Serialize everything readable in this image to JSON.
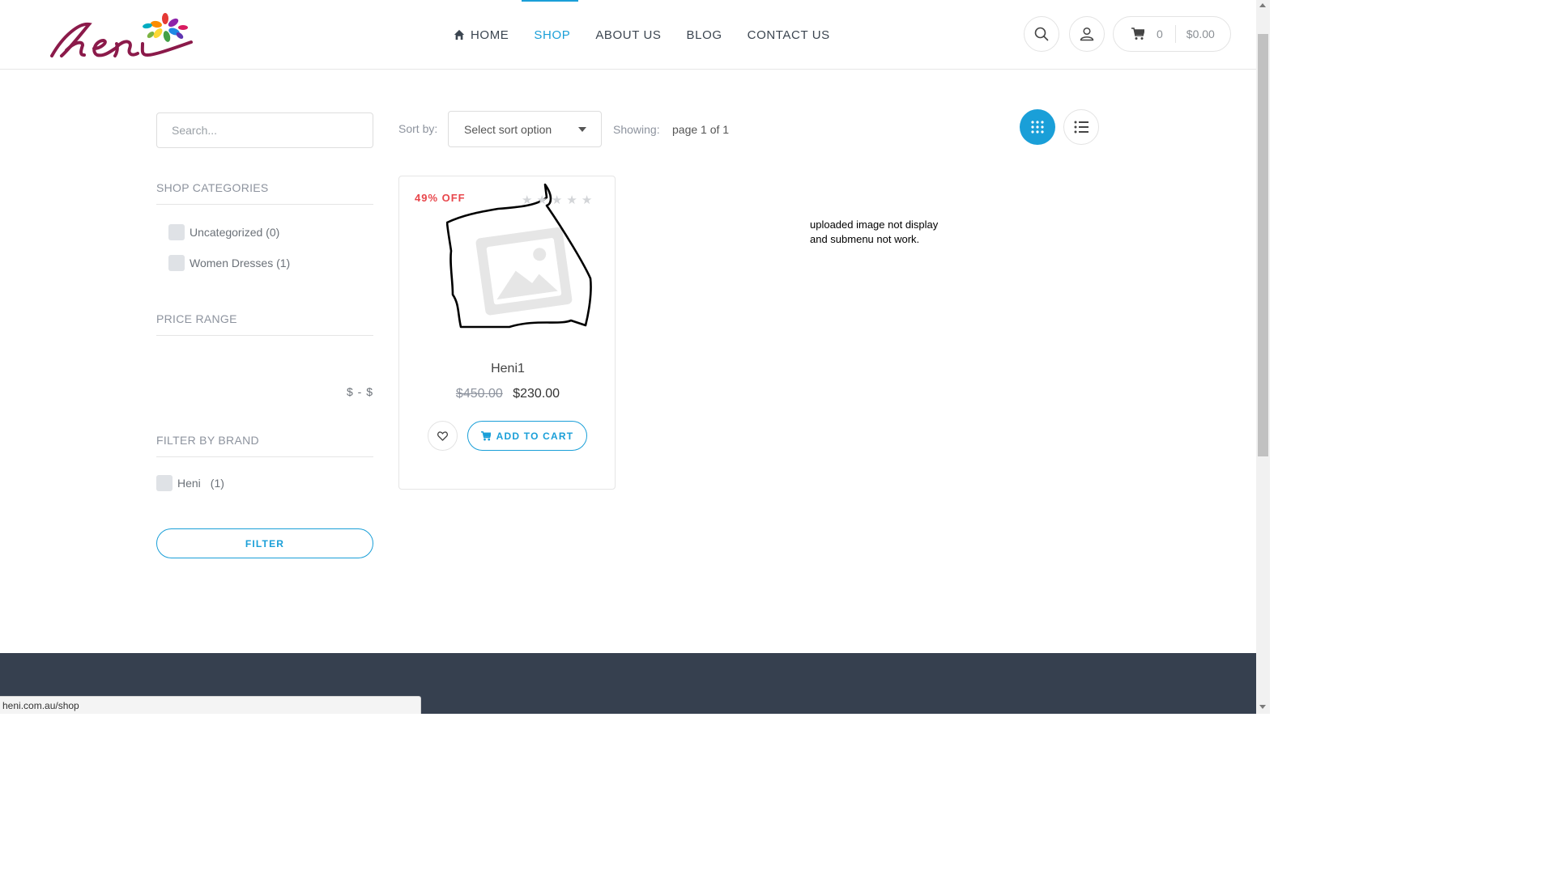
{
  "header": {
    "nav": [
      {
        "label": "HOME",
        "icon": "home-icon",
        "active": false
      },
      {
        "label": "SHOP",
        "active": true
      },
      {
        "label": "ABOUT US",
        "active": false
      },
      {
        "label": "BLOG",
        "active": false
      },
      {
        "label": "CONTACT US",
        "active": false
      }
    ],
    "cart_count": "0",
    "cart_total": "$0.00",
    "accent_color": "#1a9fd8"
  },
  "sidebar": {
    "search_placeholder": "Search...",
    "categories_title": "SHOP CATEGORIES",
    "categories": [
      {
        "label": "Uncategorized (0)"
      },
      {
        "label": "Women Dresses (1)"
      }
    ],
    "price_title": "PRICE RANGE",
    "price_range": "$ -  $",
    "brand_title": "FILTER BY BRAND",
    "brands": [
      {
        "name": "Heni",
        "count": "(1)"
      }
    ],
    "filter_label": "FILTER"
  },
  "toolbar": {
    "sort_label": "Sort by:",
    "sort_value": "Select sort option",
    "showing_label": "Showing:",
    "showing_value": "page 1 of 1"
  },
  "product": {
    "badge": "49% OFF",
    "name": "Heni1",
    "old_price": "$450.00",
    "new_price": "$230.00",
    "add_to_cart": "ADD TO CART",
    "rating_stars": 0,
    "badge_color": "#e8474c"
  },
  "note": "uploaded image not display and submenu not work.",
  "status_url": "heni.com.au/shop"
}
